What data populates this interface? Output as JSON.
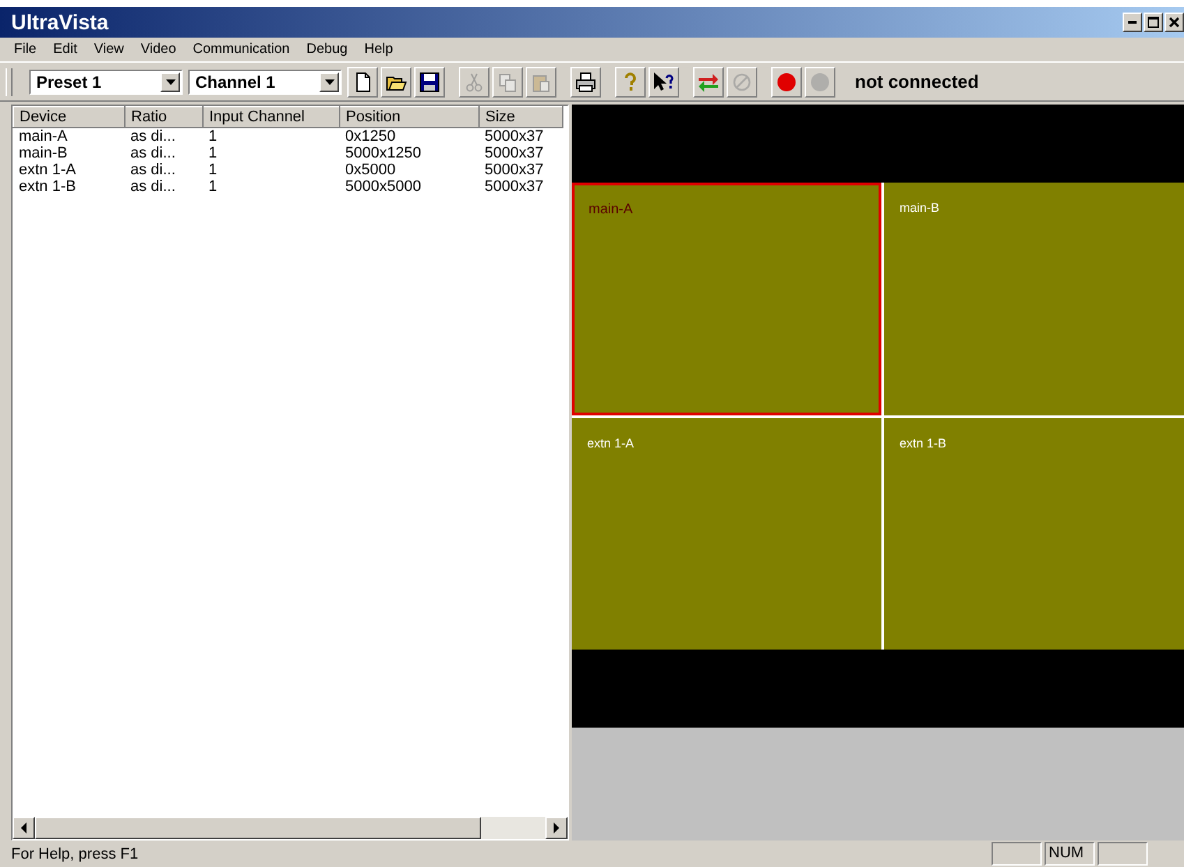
{
  "window": {
    "title": "UltraVista"
  },
  "menu": [
    "File",
    "Edit",
    "View",
    "Video",
    "Communication",
    "Debug",
    "Help"
  ],
  "toolbar": {
    "preset": {
      "value": "Preset 1"
    },
    "channel": {
      "value": "Channel 1"
    },
    "buttons": [
      {
        "kind": "new",
        "disabled": false
      },
      {
        "kind": "open",
        "disabled": false
      },
      {
        "kind": "save",
        "disabled": false
      },
      {
        "kind": "cut",
        "disabled": true
      },
      {
        "kind": "copy",
        "disabled": true
      },
      {
        "kind": "paste",
        "disabled": true
      },
      {
        "kind": "print",
        "disabled": false
      },
      {
        "kind": "help",
        "disabled": false
      },
      {
        "kind": "context-help",
        "disabled": false
      },
      {
        "kind": "transfer",
        "disabled": false
      },
      {
        "kind": "cancel",
        "disabled": true
      },
      {
        "kind": "record",
        "disabled": false
      },
      {
        "kind": "stop",
        "disabled": true
      }
    ],
    "connection_status": "not connected"
  },
  "table": {
    "columns": [
      "Device",
      "Ratio",
      "Input Channel",
      "Position",
      "Size"
    ],
    "rows": [
      [
        "main-A",
        "as di...",
        "1",
        "0x1250",
        "5000x37"
      ],
      [
        "main-B",
        "as di...",
        "1",
        "5000x1250",
        "5000x37"
      ],
      [
        "extn 1-A",
        "as di...",
        "1",
        "0x5000",
        "5000x37"
      ],
      [
        "extn 1-B",
        "as di...",
        "1",
        "5000x5000",
        "5000x37"
      ]
    ]
  },
  "layout": {
    "tiles": [
      {
        "label": "main-A",
        "selected": true
      },
      {
        "label": "main-B",
        "selected": false
      },
      {
        "label": "extn 1-A",
        "selected": false
      },
      {
        "label": "extn 1-B",
        "selected": false
      }
    ]
  },
  "status_bar": {
    "text": "For Help, press F1",
    "panels": [
      "NUM"
    ]
  }
}
